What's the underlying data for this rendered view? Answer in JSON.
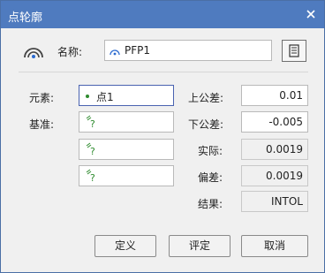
{
  "window": {
    "title": "点轮廓"
  },
  "header": {
    "name_label": "名称:",
    "name_value": "PFP1",
    "profile_icon": "point-profile-icon",
    "name_button_icon": "list-icon"
  },
  "left": {
    "element_label": "元素:",
    "datum_label": "基准:",
    "element_value": "点1",
    "datum_placeholder_icon": "unknown-feature-icon"
  },
  "right": {
    "upper_tol_label": "上公差:",
    "upper_tol_value": "0.01",
    "lower_tol_label": "下公差:",
    "lower_tol_value": "-0.005",
    "actual_label": "实际:",
    "actual_value": "0.0019",
    "deviation_label": "偏差:",
    "deviation_value": "0.0019",
    "result_label": "结果:",
    "result_value": "INTOL"
  },
  "buttons": {
    "define": "定义",
    "evaluate": "评定",
    "cancel": "取消"
  },
  "colors": {
    "titlebar": "#4f7bbf",
    "dialog_bg": "#f0f0f0",
    "point_green": "#2e8b2e"
  }
}
